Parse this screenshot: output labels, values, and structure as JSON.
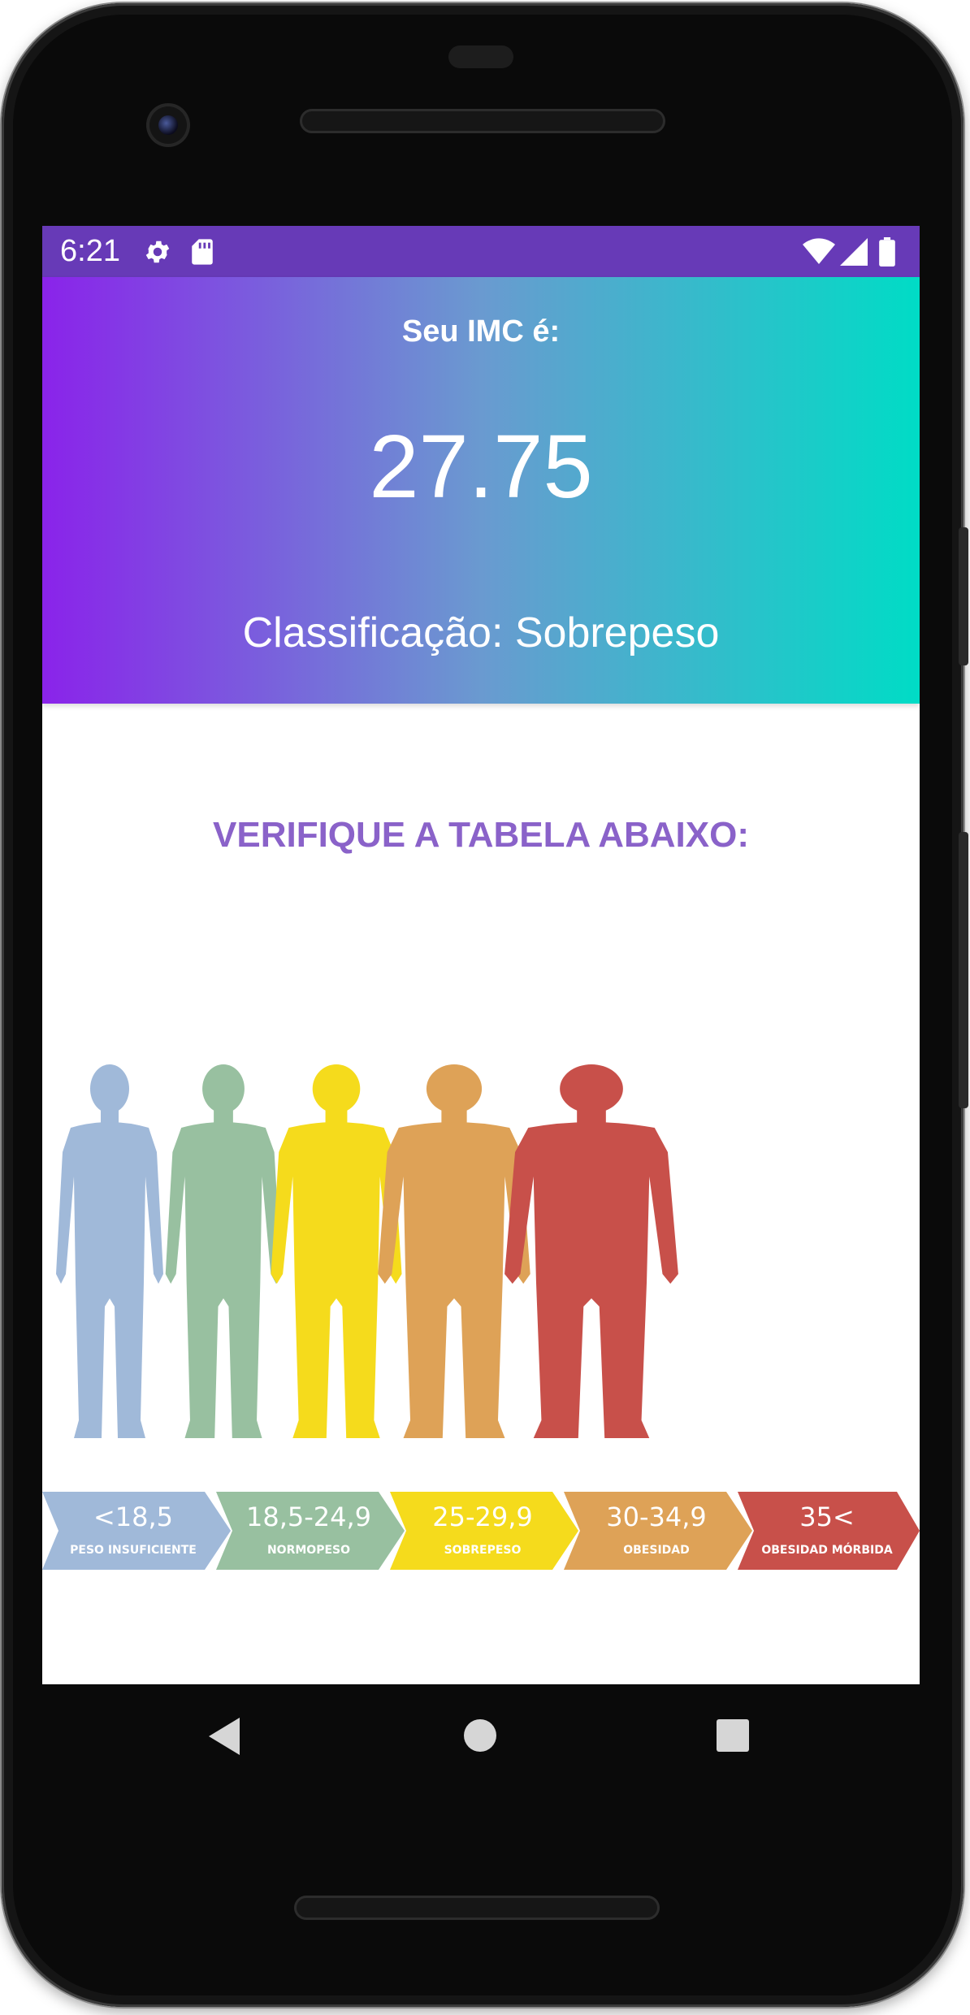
{
  "status_bar": {
    "time": "6:21",
    "icons": [
      "gear-icon",
      "sd-card-icon",
      "wifi-icon",
      "signal-icon",
      "battery-icon"
    ],
    "color": "#673ab7"
  },
  "result": {
    "label": "Seu IMC é:",
    "value": "27.75",
    "classification": "Classificação: Sobrepeso",
    "gradient": [
      "#8a23ea",
      "#6a9ad0",
      "#00dcc6"
    ]
  },
  "table": {
    "title": "VERIFIQUE A TABELA ABAIXO:",
    "title_color": "#8a62c9",
    "categories": [
      {
        "range": "<18,5",
        "name": "PESO INSUFICIENTE",
        "color": "#a0b9d9"
      },
      {
        "range": "18,5-24,9",
        "name": "NORMOPESO",
        "color": "#98c0a0"
      },
      {
        "range": "25-29,9",
        "name": "SOBREPESO",
        "color": "#f5db1c"
      },
      {
        "range": "30-34,9",
        "name": "OBESIDAD",
        "color": "#dea257"
      },
      {
        "range": "35<",
        "name": "OBESIDAD MÓRBIDA",
        "color": "#c8504a"
      }
    ]
  },
  "nav_bar": {
    "buttons": [
      "back-icon",
      "home-icon",
      "recents-icon"
    ]
  }
}
